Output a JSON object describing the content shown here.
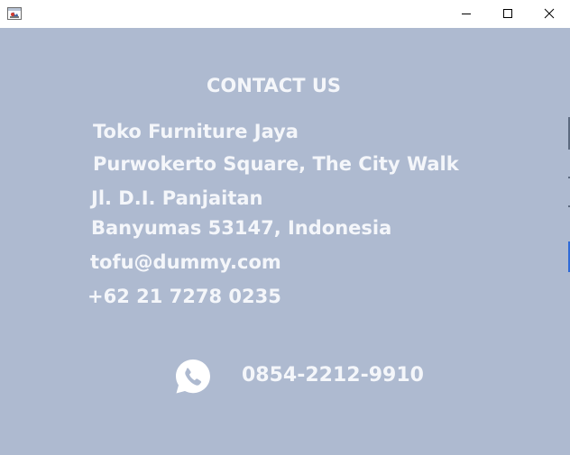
{
  "window": {
    "icons": {
      "app": "java-app-icon",
      "minimize": "minimize-icon",
      "maximize": "maximize-icon",
      "close": "close-icon"
    }
  },
  "contact": {
    "heading": "CONTACT US",
    "company": "Toko Furniture Jaya",
    "address_line1": "Purwokerto Square, The City Walk",
    "address_line2": "Jl. D.I. Panjaitan",
    "address_line3": "Banyumas 53147, Indonesia",
    "email": "tofu@dummy.com",
    "phone": "+62 21 7278 0235",
    "whatsapp_icon": "whatsapp-icon",
    "whatsapp_number": "0854-2212-9910"
  },
  "colors": {
    "background": "#aebad0",
    "text": "#f4f6fa"
  }
}
